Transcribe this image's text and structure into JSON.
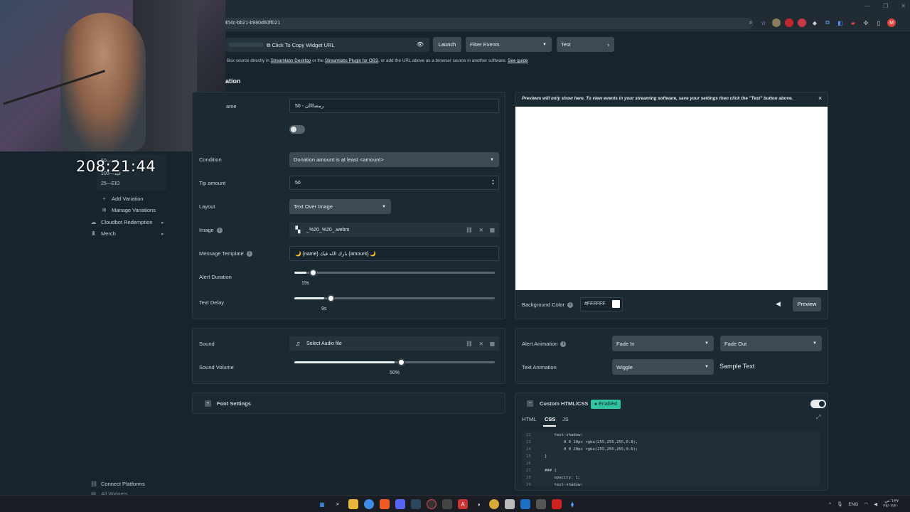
{
  "browser": {
    "url": "454c-bb21-b980d60ff021",
    "win_minimize": "—",
    "win_restore": "❐",
    "win_close": "✕",
    "avatar_letter": "M",
    "toolbar_icons": [
      "zoom-icon",
      "star-icon",
      "extension-icon",
      "extension-icon",
      "extension-icon",
      "extension-icon",
      "extension-icon",
      "extension-icon",
      "extension-icon",
      "puzzle-icon",
      "sidebar-icon"
    ]
  },
  "overlay": {
    "timer": "208:21:44"
  },
  "sidebar": {
    "variations": [
      "50—عيد",
      "100—عيد",
      "25—EID"
    ],
    "add_variation": "Add Variation",
    "manage_variations": "Manage Variations",
    "cloudbot_redemption": "Cloudbot Redemption",
    "merch": "Merch",
    "connect_platforms": "Connect Platforms",
    "all_widgets": "All Widgets"
  },
  "top_bar": {
    "copy_url_label": "Click To Copy Widget URL",
    "launch_label": "Launch",
    "filter_events_label": "Filter Events",
    "test_label": "Test",
    "help_prefix": "Box source directly in",
    "help_link1": "Streamlabs Desktop",
    "help_mid": "or the",
    "help_link2": "Streamlabs Plugin for OBS",
    "help_suffix": ", or add the URL above as a browser source in another software.",
    "help_link3": "See guide"
  },
  "section": {
    "heading": "ation"
  },
  "variation_form": {
    "name_label": "ame",
    "name_value": "50 - رمضاااان",
    "condition_label": "Condition",
    "condition_value": "Donation amount is at least <amount>",
    "tip_amount_label": "Tip amount",
    "tip_amount_value": "50",
    "layout_label": "Layout",
    "layout_value": "Text Over Image",
    "image_label": "Image",
    "image_file": "_%20_%20_.webm",
    "message_template_label": "Message Template",
    "message_template_value": "🌙 {name} بارك الله فيك {amount} 🌙",
    "alert_duration_label": "Alert Duration",
    "alert_duration_value": "19s",
    "alert_duration_fraction": 0.06,
    "text_delay_label": "Text Delay",
    "text_delay_value": "9s",
    "text_delay_fraction": 0.15
  },
  "sound_panel": {
    "sound_label": "Sound",
    "sound_file": "Select Audio file",
    "volume_label": "Sound Volume",
    "volume_value": "50%",
    "volume_fraction": 0.5
  },
  "font_panel": {
    "label": "Font Settings"
  },
  "preview": {
    "note": "Previews will only show here. To view events in your streaming software, save your settings then click the \"Test\" button above.",
    "close": "×",
    "background_color_label": "Background Color",
    "background_color_value": "#FFFFFF",
    "preview_label": "Preview"
  },
  "animation_panel": {
    "alert_animation_label": "Alert Animation",
    "fade_in": "Fade In",
    "fade_out": "Fade Out",
    "text_animation_label": "Text Animation",
    "text_animation_value": "Wiggle",
    "sample_text": "Sample Text"
  },
  "code_panel": {
    "title": "Custom HTML/CSS",
    "badge": "● Enabled",
    "tabs": [
      "HTML",
      "CSS",
      "JS"
    ],
    "lines": [
      {
        "n": "22",
        "t": "    text-shadow:"
      },
      {
        "n": "23",
        "t": "        0 0 10px rgba(255,255,255,0.8),"
      },
      {
        "n": "24",
        "t": "        0 0 20px rgba(255,255,255,0.6);"
      },
      {
        "n": "25",
        "t": "}"
      },
      {
        "n": "26",
        "t": ""
      },
      {
        "n": "27",
        "t": "### {"
      },
      {
        "n": "28",
        "t": "    opacity: 1;"
      },
      {
        "n": "29",
        "t": "    text-shadow:"
      }
    ]
  },
  "taskbar": {
    "lang": "ENG",
    "time": "٦:٣٧ ص",
    "date": "٢٧/٠٢/٢٠"
  },
  "colors": {
    "page_bg": "#17242d",
    "panel_bg": "#1b2932",
    "control_bg": "#3b4a55",
    "enabled_green": "#31c3a2"
  }
}
